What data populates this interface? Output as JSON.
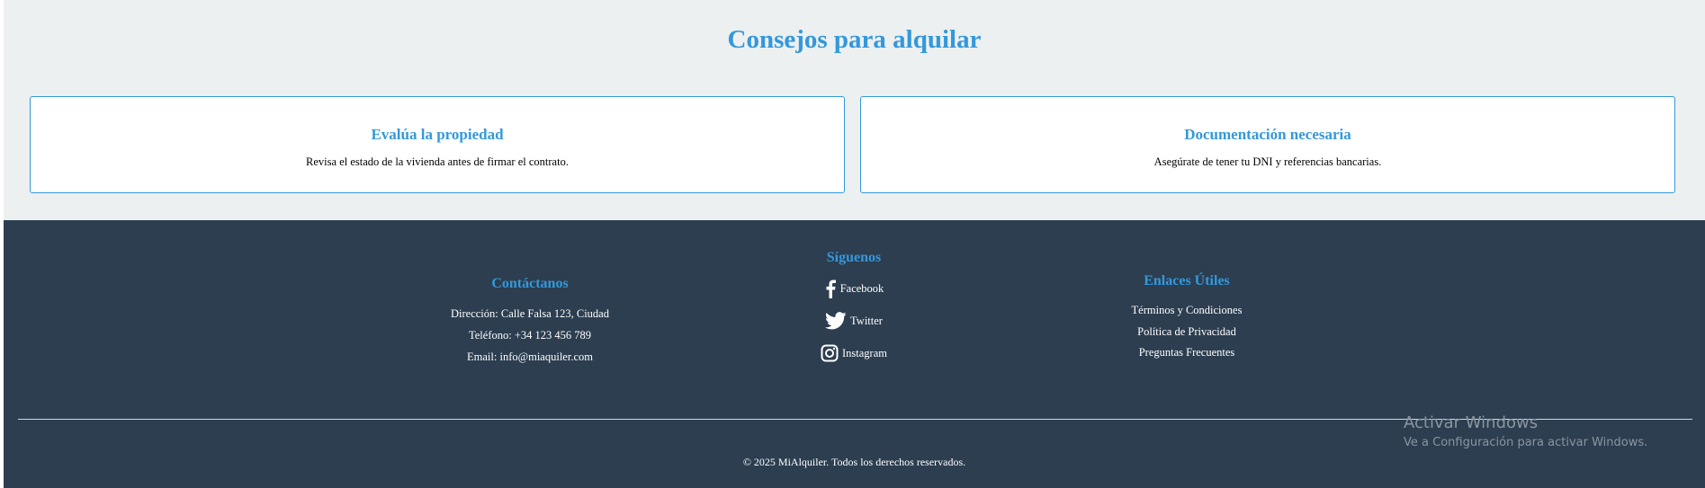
{
  "tips": {
    "title": "Consejos para alquilar",
    "cards": [
      {
        "title": "Evalúa la propiedad",
        "text": "Revisa el estado de la vivienda antes de firmar el contrato."
      },
      {
        "title": "Documentación necesaria",
        "text": "Asegúrate de tener tu DNI y referencias bancarias."
      }
    ]
  },
  "footer": {
    "contact": {
      "title": "Contáctanos",
      "address": "Dirección: Calle Falsa 123, Ciudad",
      "phone": "Teléfono: +34 123 456 789",
      "email": "Email: info@miaquiler.com"
    },
    "social": {
      "title": "Síguenos",
      "links": [
        {
          "label": "Facebook",
          "icon": "facebook-icon"
        },
        {
          "label": "Twitter",
          "icon": "twitter-icon"
        },
        {
          "label": "Instagram",
          "icon": "instagram-icon"
        }
      ]
    },
    "links": {
      "title": "Enlaces Útiles",
      "items": [
        "Términos y Condiciones",
        "Política de Privacidad",
        "Preguntas Frecuentes"
      ]
    },
    "copyright": "© 2025 MiAlquiler. Todos los derechos reservados."
  },
  "watermark": {
    "title": "Activar Windows",
    "subtitle": "Ve a Configuración para activar Windows."
  },
  "colors": {
    "accent": "#3498db",
    "footer_bg": "#2c3e50",
    "section_bg": "#ecf0f1"
  }
}
